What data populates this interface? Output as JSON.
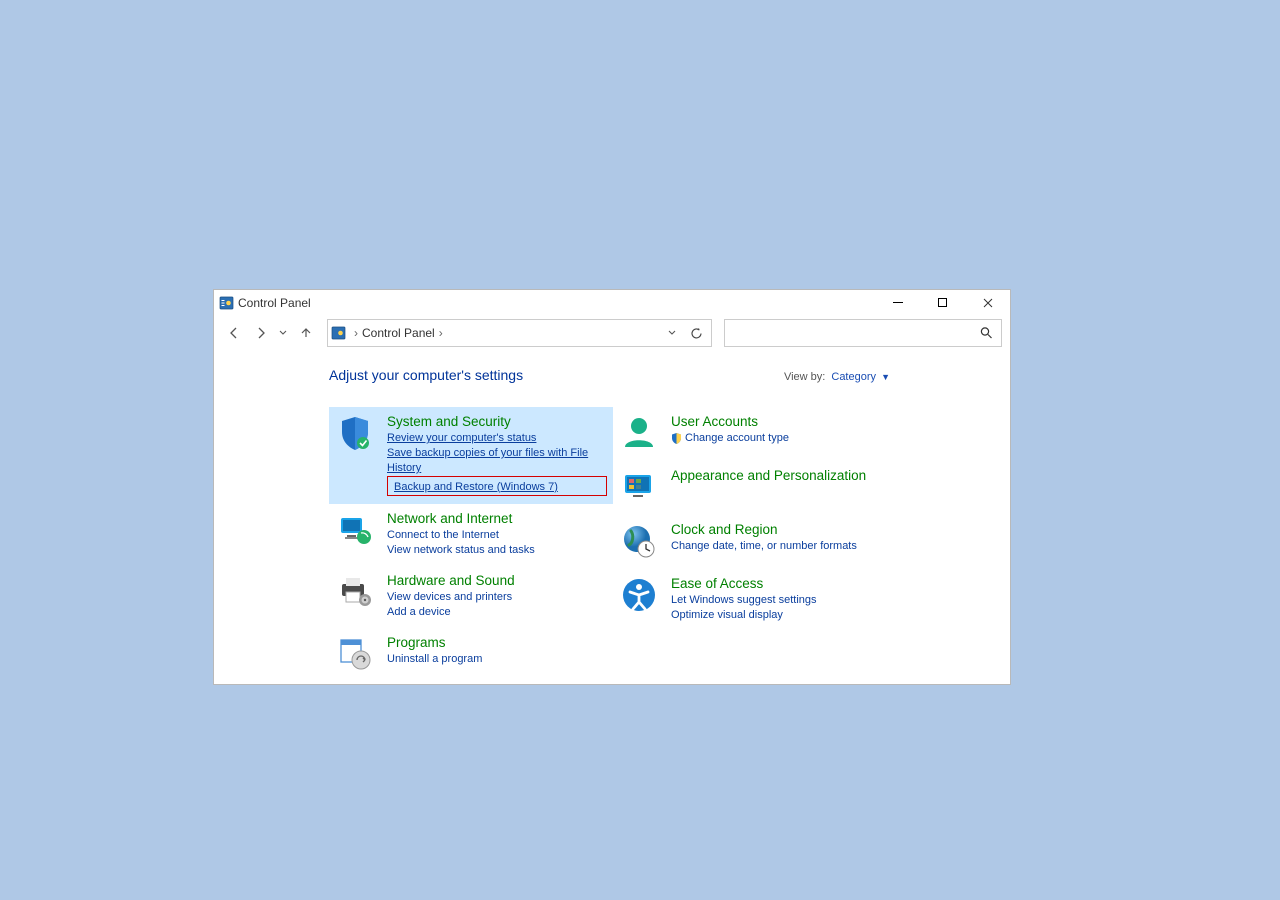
{
  "window": {
    "title": "Control Panel"
  },
  "nav": {
    "address_root": "Control Panel",
    "search_placeholder": ""
  },
  "content": {
    "heading": "Adjust your computer's settings",
    "viewby_label": "View by:",
    "viewby_value": "Category",
    "categories_left": [
      {
        "title": "System and Security",
        "links": [
          "Review your computer's status",
          "Save backup copies of your files with File History",
          "Backup and Restore (Windows 7)"
        ],
        "highlighted": true,
        "red_link_idx": 2
      },
      {
        "title": "Network and Internet",
        "links": [
          "Connect to the Internet",
          "View network status and tasks"
        ]
      },
      {
        "title": "Hardware and Sound",
        "links": [
          "View devices and printers",
          "Add a device"
        ]
      },
      {
        "title": "Programs",
        "links": [
          "Uninstall a program"
        ]
      }
    ],
    "categories_right": [
      {
        "title": "User Accounts",
        "links": [
          "Change account type"
        ],
        "shield": true
      },
      {
        "title": "Appearance and Personalization",
        "links": []
      },
      {
        "title": "Clock and Region",
        "links": [
          "Change date, time, or number formats"
        ]
      },
      {
        "title": "Ease of Access",
        "links": [
          "Let Windows suggest settings",
          "Optimize visual display"
        ]
      }
    ]
  }
}
